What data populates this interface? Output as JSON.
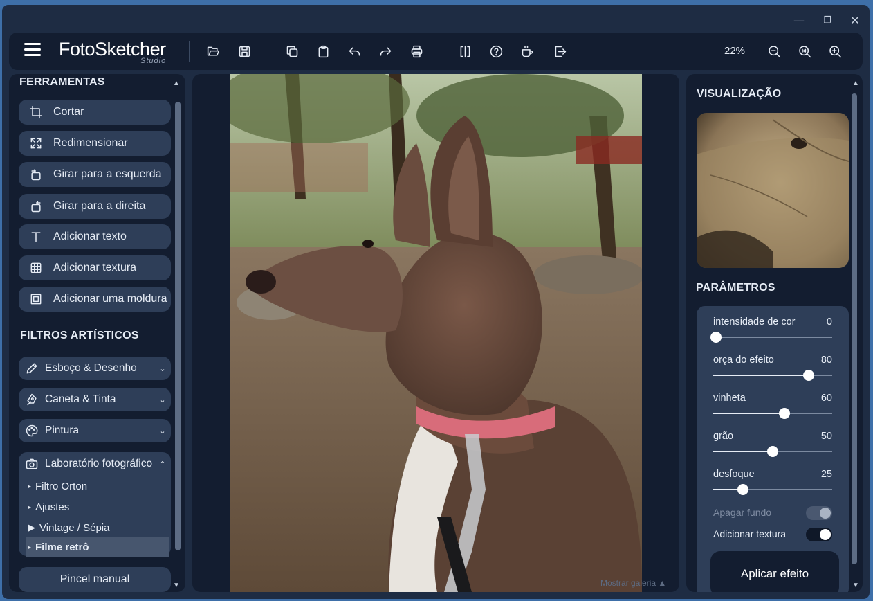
{
  "window": {
    "minimize_icon": "minimize-icon",
    "maximize_icon": "restore-icon",
    "close_icon": "close-icon"
  },
  "app": {
    "name": "FotoSketcher",
    "edition": "Studio"
  },
  "toolbar": {
    "icons": [
      "menu-icon",
      "folder-open-icon",
      "save-icon",
      "copy-icon",
      "paste-icon",
      "undo-icon",
      "redo-icon",
      "print-icon",
      "compare-icon",
      "help-icon",
      "coffee-icon",
      "exit-icon",
      "zoom-out-icon",
      "zoom-actual-icon",
      "zoom-in-icon"
    ],
    "zoom_label": "22%"
  },
  "left_panel": {
    "tools_header": "FERRAMENTAS",
    "tools": [
      {
        "label": "Cortar",
        "icon": "crop-icon"
      },
      {
        "label": "Redimensionar",
        "icon": "resize-icon"
      },
      {
        "label": "Girar para a esquerda",
        "icon": "rotate-left-icon"
      },
      {
        "label": "Girar para a direita",
        "icon": "rotate-right-icon"
      },
      {
        "label": "Adicionar texto",
        "icon": "text-icon"
      },
      {
        "label": "Adicionar textura",
        "icon": "texture-icon"
      },
      {
        "label": "Adicionar uma moldura",
        "icon": "frame-icon"
      }
    ],
    "filters_header": "FILTROS ARTÍSTICOS",
    "filters": [
      {
        "label": "Esboço & Desenho",
        "icon": "pencil-icon",
        "expanded": false
      },
      {
        "label": "Caneta & Tinta",
        "icon": "pen-icon",
        "expanded": false
      },
      {
        "label": "Pintura",
        "icon": "palette-icon",
        "expanded": false
      },
      {
        "label": "Laboratório fotográfico",
        "icon": "camera-icon",
        "expanded": true
      }
    ],
    "lab_items": [
      {
        "label": "Filtro Orton",
        "bullet": "▸"
      },
      {
        "label": "Ajustes",
        "bullet": "▸"
      },
      {
        "label": "Vintage / Sépia",
        "bullet": "▶"
      },
      {
        "label": "Filme retrô",
        "bullet": "▸",
        "selected": true
      }
    ],
    "manual_brush": "Pincel manual"
  },
  "canvas": {
    "gallery_label": "Mostrar galeria"
  },
  "right_panel": {
    "preview_header": "VISUALIZAÇÃO",
    "params_header": "PARÂMETROS",
    "params": [
      {
        "label": "intensidade de cor",
        "value": 0,
        "max": 100
      },
      {
        "label": "orça do efeito",
        "value": 80,
        "max": 100
      },
      {
        "label": "vinheta",
        "value": 60,
        "max": 100
      },
      {
        "label": "grão",
        "value": 50,
        "max": 100
      },
      {
        "label": "desfoque",
        "value": 25,
        "max": 100
      }
    ],
    "toggles": [
      {
        "label": "Apagar fundo",
        "on": false
      },
      {
        "label": "Adicionar textura",
        "on": true
      }
    ],
    "apply_button": "Aplicar efeito"
  }
}
